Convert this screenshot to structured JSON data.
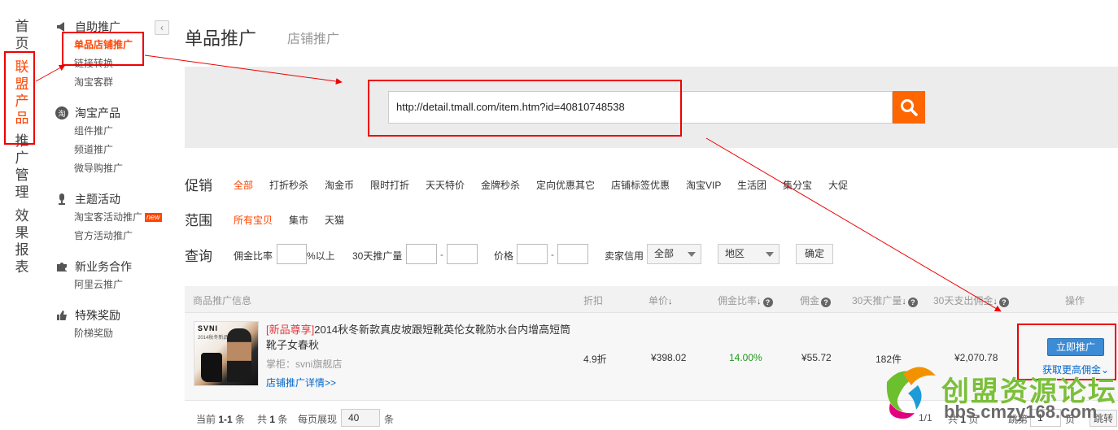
{
  "left_nav": {
    "items": [
      {
        "label": "首页"
      },
      {
        "label": "联盟产品"
      },
      {
        "label": "推广管理"
      },
      {
        "label": "效果报表"
      }
    ]
  },
  "sidebar": {
    "collapse_glyph": "‹",
    "groups": [
      {
        "title": "自助推广",
        "icon": "megaphone-icon",
        "links": [
          {
            "label": "单品店铺推广"
          },
          {
            "label": "链接转换"
          },
          {
            "label": "淘宝客群"
          }
        ]
      },
      {
        "title": "淘宝产品",
        "icon": "taobao-icon",
        "icon_text": "淘",
        "links": [
          {
            "label": "组件推广"
          },
          {
            "label": "频道推广"
          },
          {
            "label": "微导购推广"
          }
        ]
      },
      {
        "title": "主题活动",
        "icon": "microphone-icon",
        "links": [
          {
            "label": "淘宝客活动推广",
            "badge": "new"
          },
          {
            "label": "官方活动推广"
          }
        ]
      },
      {
        "title": "新业务合作",
        "icon": "puzzle-icon",
        "links": [
          {
            "label": "阿里云推广"
          }
        ]
      },
      {
        "title": "特殊奖励",
        "icon": "thumbs-up-icon",
        "links": [
          {
            "label": "阶梯奖励"
          }
        ]
      }
    ]
  },
  "header": {
    "title": "单品推广",
    "tab": "店铺推广"
  },
  "search": {
    "value": "http://detail.tmall.com/item.htm?id=40810748538",
    "button_icon": "search-icon"
  },
  "filters": {
    "promo": {
      "label": "促销",
      "options": [
        "全部",
        "打折秒杀",
        "淘金币",
        "限时打折",
        "天天特价",
        "金牌秒杀",
        "定向优惠其它",
        "店铺标签优惠",
        "淘宝VIP",
        "生活团",
        "集分宝",
        "大促"
      ]
    },
    "scope": {
      "label": "范围",
      "options": [
        "所有宝贝",
        "集市",
        "天猫"
      ]
    },
    "query": {
      "label": "查询",
      "commission_label": "佣金比率",
      "commission_suffix": "%以上",
      "volume_label": "30天推广量",
      "price_label": "价格",
      "dash": "-",
      "seller_label": "卖家信用",
      "seller_value": "全部",
      "region_value": "地区",
      "confirm": "确定"
    }
  },
  "table": {
    "headers": {
      "info": "商品推广信息",
      "discount": "折扣",
      "price": "单价",
      "rate": "佣金比率",
      "commission": "佣金",
      "volume": "30天推广量",
      "spend": "30天支出佣金",
      "action": "操作"
    },
    "sort_glyph": "↓",
    "help_glyph": "?",
    "row": {
      "thumb_brand": "SVNI",
      "thumb_caption": "2014秋冬新品",
      "tag": "[新品尊享]",
      "title": "2014秋冬新款真皮坡跟短靴英伦女靴防水台内增高短筒靴子女春秋",
      "shop": "掌柜：svni旗舰店",
      "detail_link": "店铺推广详情>>",
      "discount": "4.9折",
      "price": "¥398.02",
      "rate": "14.00%",
      "commission": "¥55.72",
      "volume": "182件",
      "spend": "¥2,070.78",
      "action_button": "立即推广",
      "more_link": "获取更高佣金",
      "more_chevron": "⌄"
    }
  },
  "pager": {
    "current_label": "当前",
    "current_range": "1-1",
    "unit1": "条",
    "total_label": "共",
    "total": "1",
    "unit2": "条",
    "per_page_label": "每页展现",
    "per_page": "40",
    "unit3": "条",
    "page_info": "1/1",
    "pages_label": "共",
    "pages_total": "1",
    "pages_unit": "页",
    "goto_label": "跳第",
    "goto_value": "1",
    "goto_unit": "页",
    "goto_button": "跳转"
  },
  "watermark": {
    "text": "创盟资源论坛",
    "url": "bbs.cmzy168.com"
  },
  "colors": {
    "accent": "#ff6600",
    "active": "#ff4400",
    "link": "#0066cc",
    "annotation": "#ee0000",
    "positive": "#1a9a1a"
  }
}
